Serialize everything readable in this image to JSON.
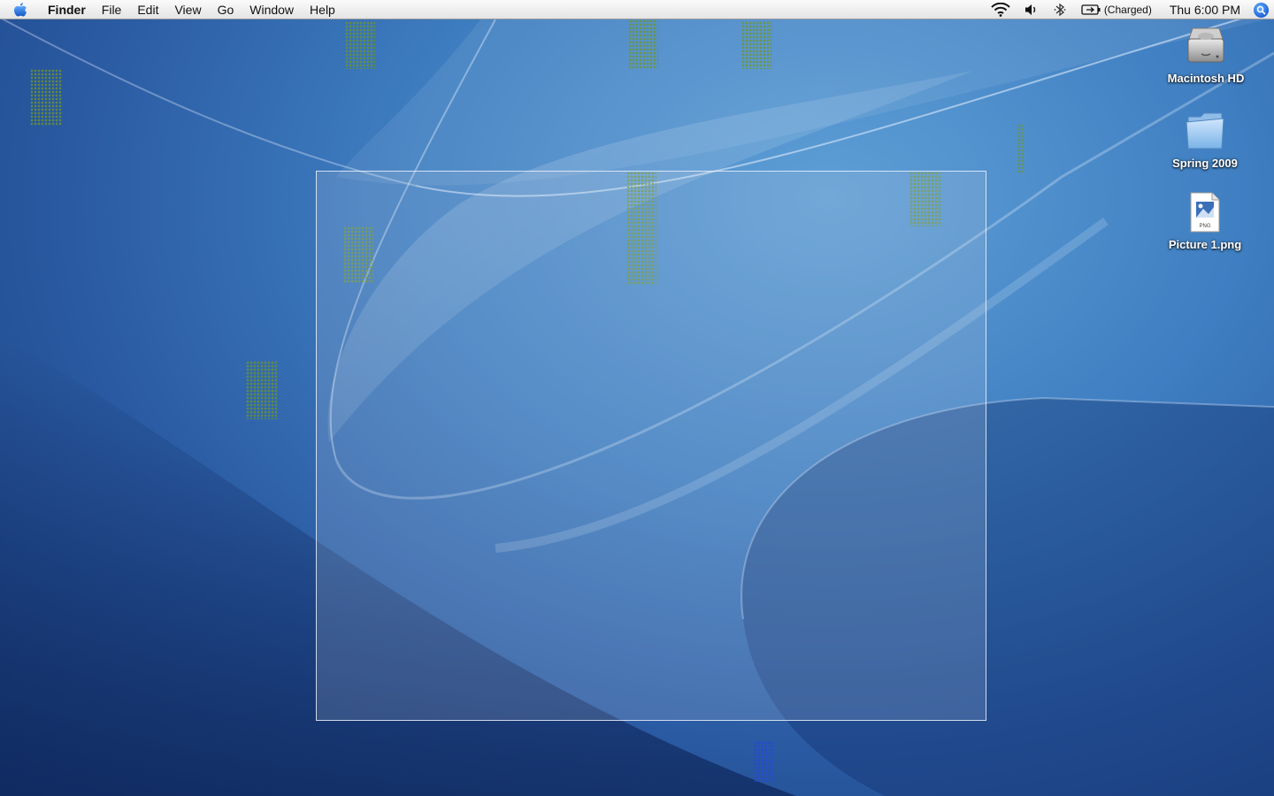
{
  "menubar": {
    "apple_icon": "apple-logo-icon",
    "app_name": "Finder",
    "menus": [
      "File",
      "Edit",
      "View",
      "Go",
      "Window",
      "Help"
    ],
    "status": {
      "wifi_icon": "wifi-icon",
      "volume_icon": "speaker-volume-icon",
      "bluetooth_icon": "bluetooth-icon",
      "battery_icon": "battery-icon",
      "battery_text": "(Charged)",
      "clock": "Thu 6:00 PM",
      "spotlight_icon": "spotlight-search-icon"
    }
  },
  "desktop_icons": [
    {
      "label": "Macintosh HD",
      "icon": "hard-drive-icon"
    },
    {
      "label": "Spring 2009",
      "icon": "folder-icon"
    },
    {
      "label": "Picture 1.png",
      "icon": "png-file-icon"
    }
  ],
  "png_badge": "PNG",
  "colors": {
    "wallpaper_light": "#5f9fd6",
    "wallpaper_mid": "#2a5aa2",
    "wallpaper_dark": "#173a78",
    "menubar": "#ececec",
    "spotlight": "#1d63d8"
  }
}
